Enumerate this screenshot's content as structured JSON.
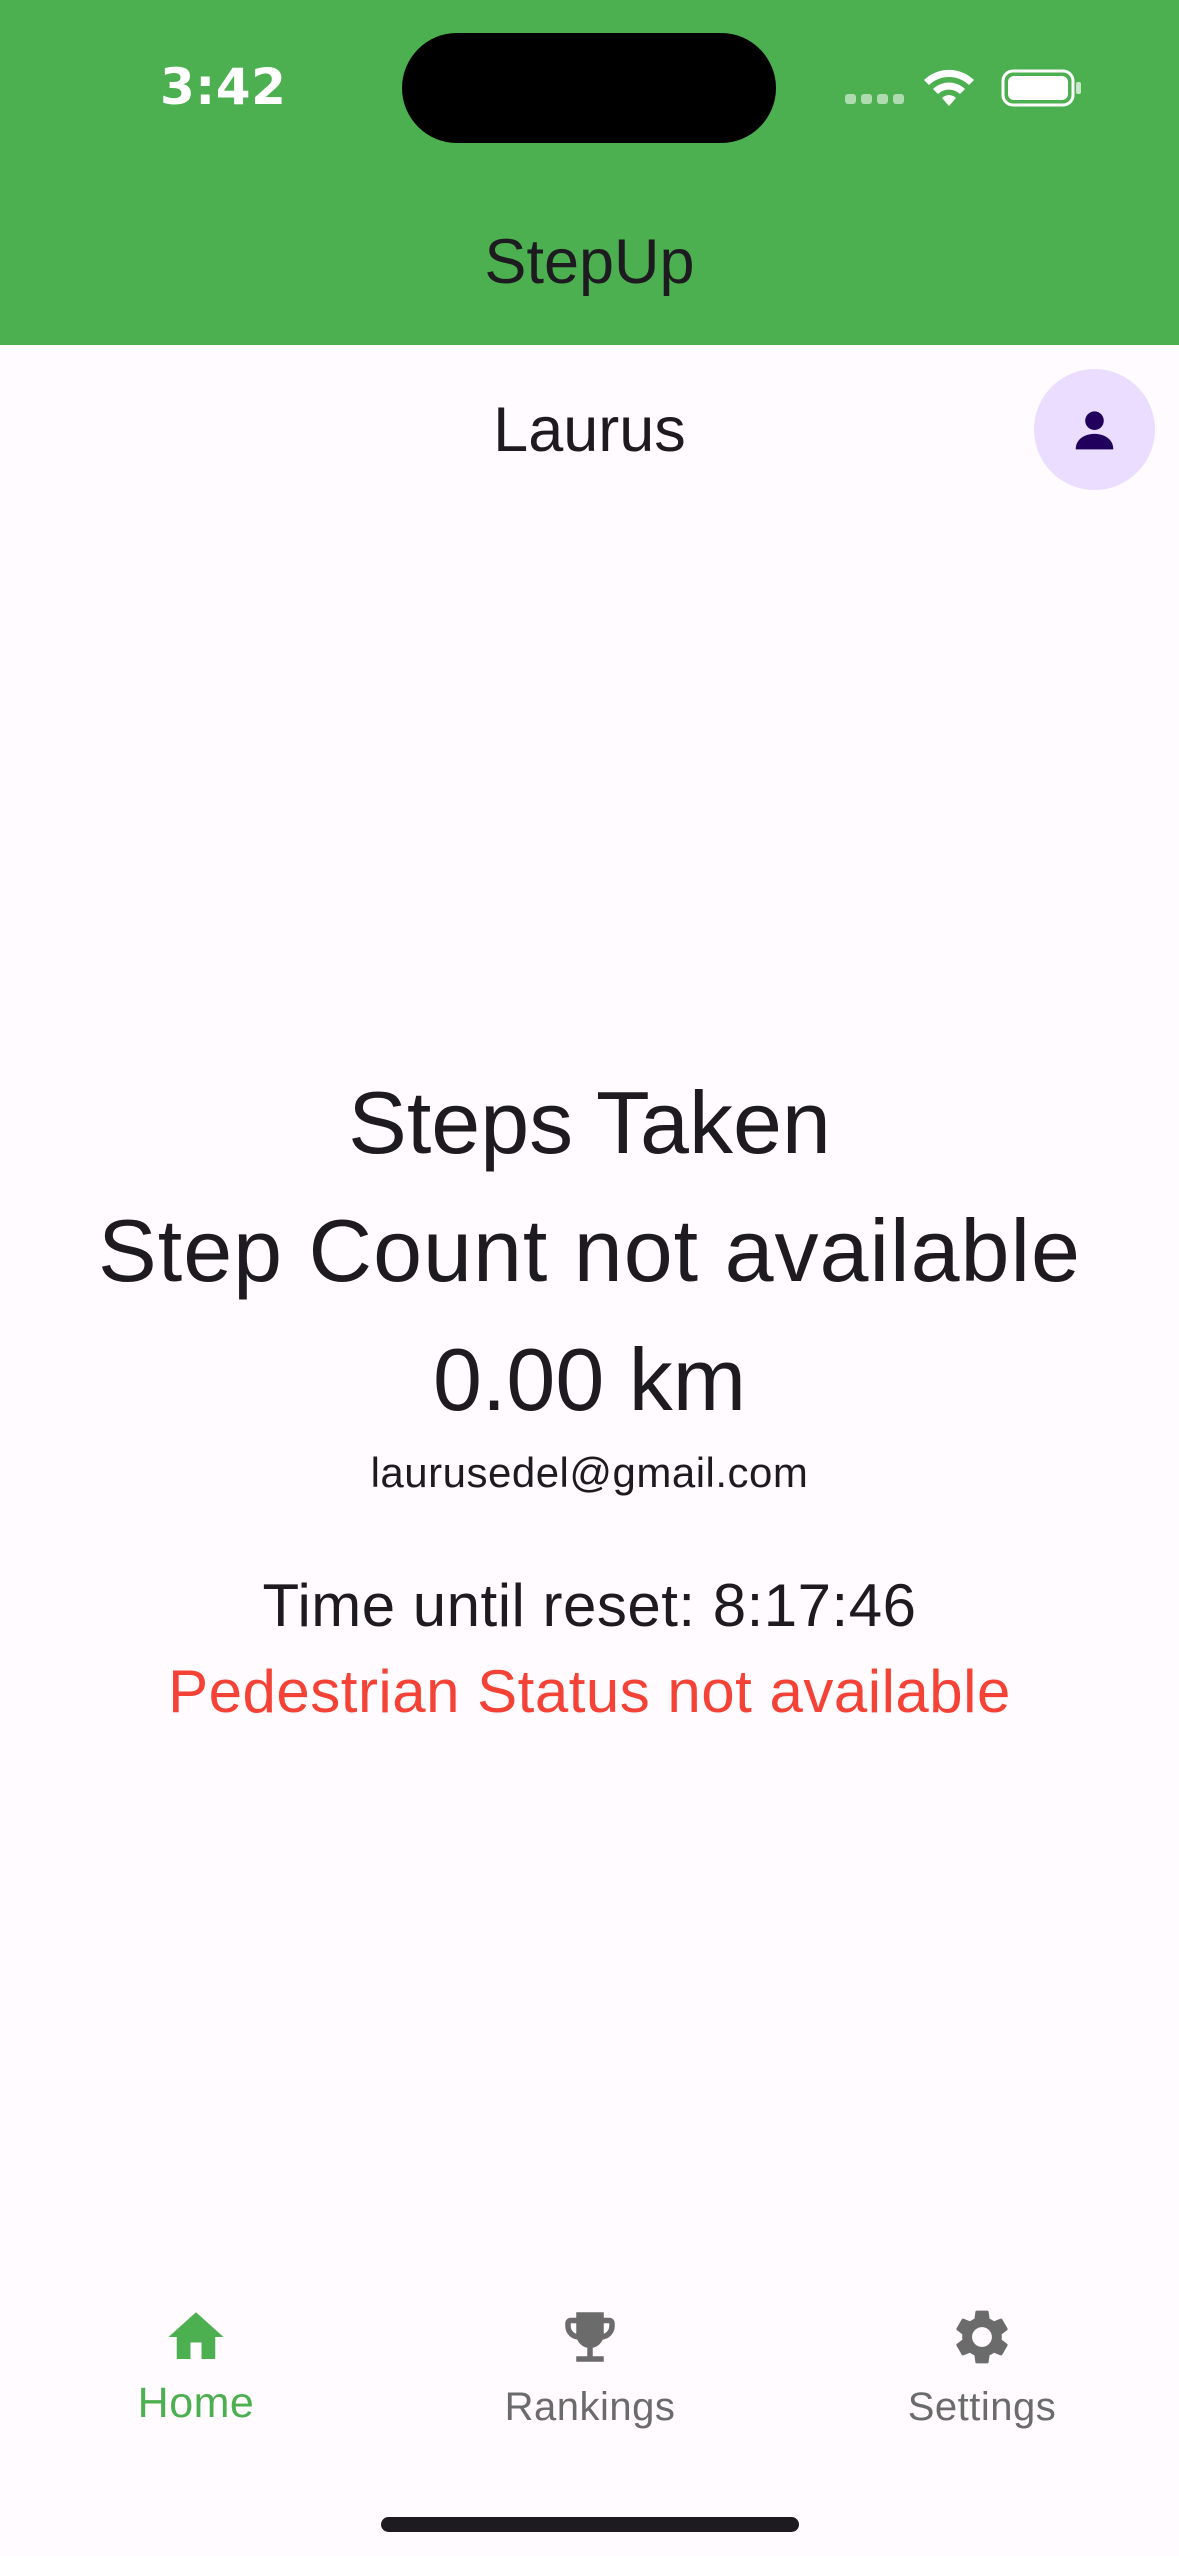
{
  "status_bar": {
    "time": "3:42"
  },
  "header": {
    "title": "StepUp",
    "background_color": "#4caf50"
  },
  "user": {
    "name": "Laurus",
    "avatar_icon": "person-icon",
    "avatar_bg_color": "#eaddff"
  },
  "main": {
    "steps_title": "Steps Taken",
    "step_count": "Step Count not available",
    "distance": "0.00 km",
    "email": "laurusedel@gmail.com",
    "timer": "Time until reset: 8:17:46",
    "pedestrian_status": "Pedestrian Status not available",
    "error_color": "#f44336"
  },
  "bottom_nav": {
    "active_color": "#4caf50",
    "inactive_color": "#6b6b6b",
    "items": [
      {
        "label": "Home",
        "icon": "home-icon",
        "active": true
      },
      {
        "label": "Rankings",
        "icon": "trophy-icon",
        "active": false
      },
      {
        "label": "Settings",
        "icon": "gear-icon",
        "active": false
      }
    ]
  }
}
